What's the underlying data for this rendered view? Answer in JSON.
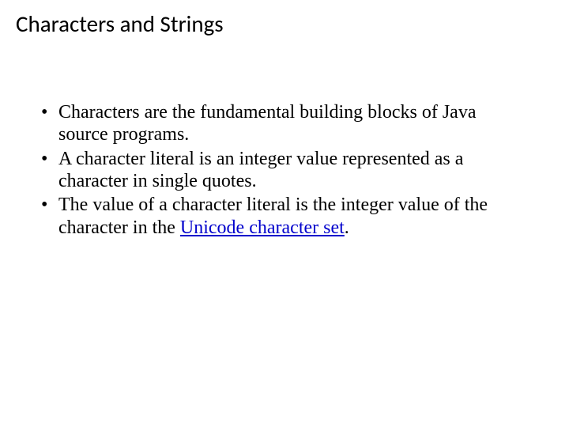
{
  "title": "Characters and Strings",
  "bullets": {
    "b1": "Characters are the fundamental building blocks of Java source programs.",
    "b2": "A character literal is an integer value represented as a character in single quotes.",
    "b3_pre": "The value of a character literal is the integer value of the character in the ",
    "b3_link": "Unicode character set",
    "b3_post": "."
  }
}
